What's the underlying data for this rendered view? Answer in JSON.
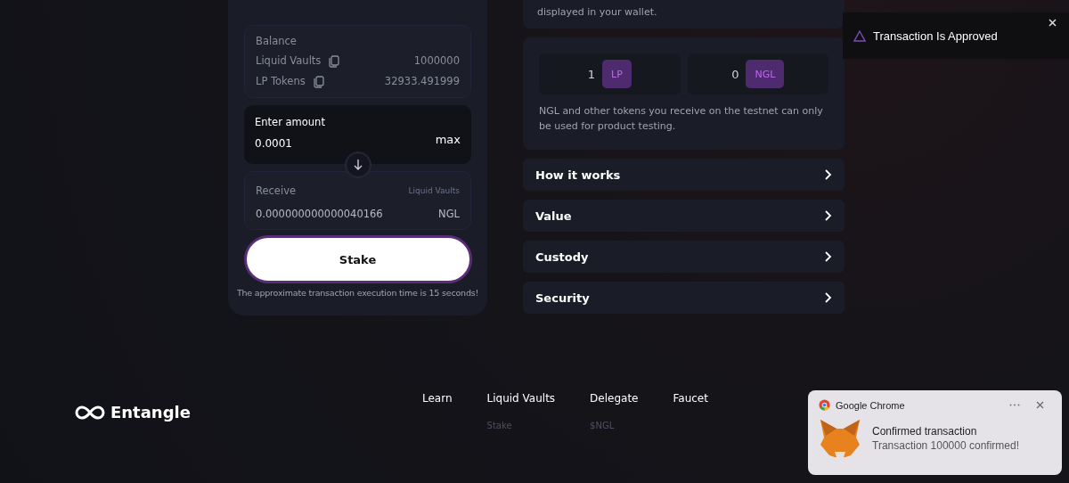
{
  "stake_card": {
    "balance": {
      "title": "Balance",
      "rows": [
        {
          "label": "Liquid Vaults",
          "value": "1000000"
        },
        {
          "label": "LP Tokens",
          "value": "32933.491999"
        }
      ]
    },
    "amount": {
      "label": "Enter amount",
      "value": "0.0001",
      "max": "max"
    },
    "receive": {
      "label": "Receive",
      "source": "Liquid Vaults",
      "value": "0.000000000000040166",
      "unit": "NGL"
    },
    "button": "Stake",
    "note": "The approximate transaction execution time is 15 seconds!"
  },
  "info_card": {
    "text": "displayed in your wallet."
  },
  "tokens_card": {
    "tokens": [
      {
        "amount": "1",
        "symbol": "LP"
      },
      {
        "amount": "0",
        "symbol": "NGL"
      }
    ],
    "note": "NGL and other tokens you receive on the testnet can only be used for product testing."
  },
  "accordion": [
    {
      "title": "How it works",
      "expanded": false
    },
    {
      "title": "Value",
      "expanded": false
    },
    {
      "title": "Custody",
      "expanded": false
    },
    {
      "title": "Security",
      "expanded": false
    }
  ],
  "toast": {
    "message": "Transaction Is Approved"
  },
  "footer": {
    "logo": "Entangle",
    "columns": [
      {
        "title": "Learn"
      },
      {
        "title": "Liquid Vaults",
        "links": [
          "Stake"
        ]
      },
      {
        "title": "Delegate",
        "links": [
          "$NGL"
        ]
      },
      {
        "title": "Faucet"
      }
    ]
  },
  "notification": {
    "app": "Google Chrome",
    "title": "Confirmed transaction",
    "body": "Transaction 100000 confirmed!"
  }
}
